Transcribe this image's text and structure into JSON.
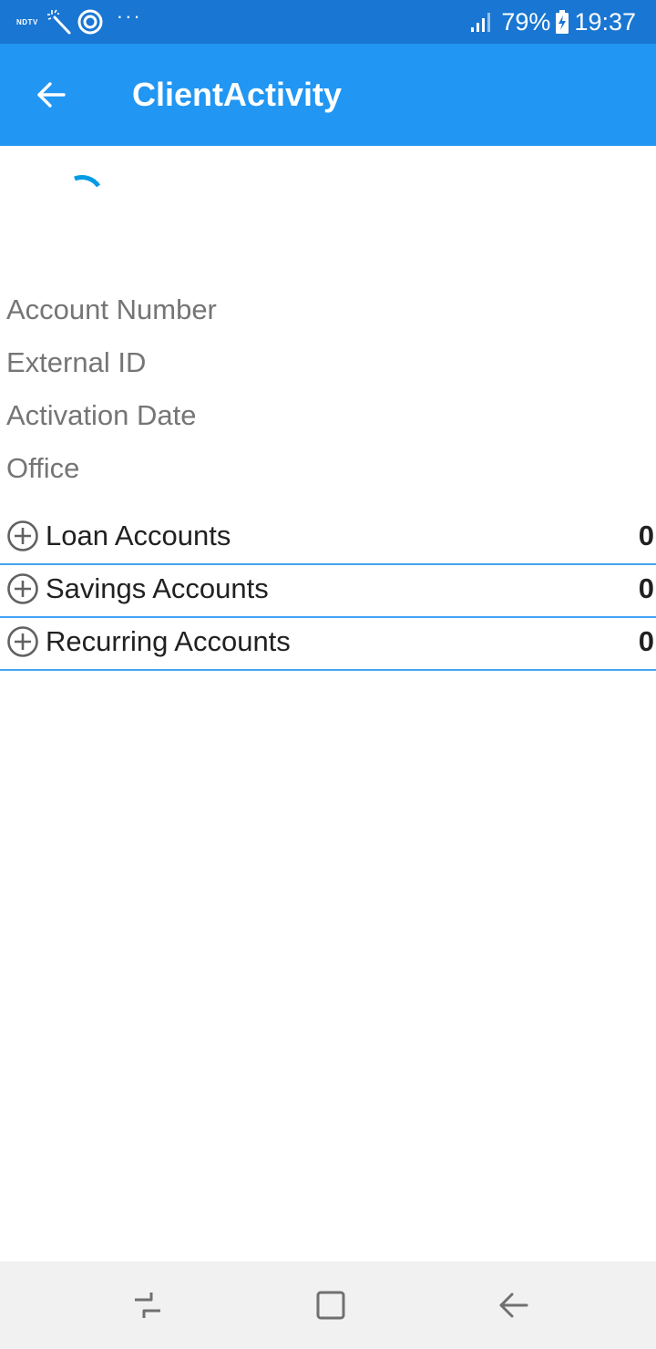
{
  "status_bar": {
    "left_label": "NDTV",
    "battery_percent": "79%",
    "time": "19:37",
    "more_indicator": "···",
    "icons": [
      "magic-wand-icon",
      "circle-sync-icon",
      "signal-icon",
      "battery-charging-icon"
    ]
  },
  "app_bar": {
    "title": "ClientActivity",
    "back_icon": "arrow-left-icon"
  },
  "loading": {
    "spinner_color": "#039be5"
  },
  "client_info": {
    "labels": [
      "Account Number",
      "External ID",
      "Activation Date",
      "Office"
    ]
  },
  "accounts": [
    {
      "label": "Loan Accounts",
      "count": "0",
      "icon": "plus-circle-icon"
    },
    {
      "label": "Savings Accounts",
      "count": "0",
      "icon": "plus-circle-icon"
    },
    {
      "label": "Recurring Accounts",
      "count": "0",
      "icon": "plus-circle-icon"
    }
  ],
  "nav_bar": {
    "icons": [
      "recent-apps-icon",
      "home-icon",
      "back-icon"
    ]
  },
  "colors": {
    "status_bar": "#1976d2",
    "app_bar": "#2196f3",
    "divider": "#42a5f5",
    "label_text": "#757575",
    "primary_text": "#212121"
  }
}
